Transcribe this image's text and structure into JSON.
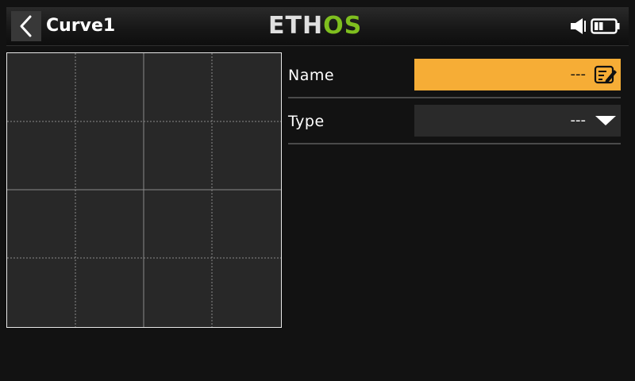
{
  "header": {
    "back_icon": "chevron-left-icon",
    "title": "Curve1",
    "logo_part1": "ETH",
    "logo_part2": "OS",
    "logo_colors": {
      "primary": "#e0e0e0",
      "accent": "#7fbf1f"
    },
    "status_icons": [
      "speaker-icon",
      "battery-icon"
    ]
  },
  "graph": {
    "grid_divisions": 4,
    "border_color": "#e8e8e8",
    "background": "#282828"
  },
  "form": {
    "name": {
      "label": "Name",
      "value": "---",
      "icon": "edit-icon",
      "accent": "#f6ad36"
    },
    "type": {
      "label": "Type",
      "value": "---",
      "icon": "dropdown-triangle-icon"
    }
  }
}
